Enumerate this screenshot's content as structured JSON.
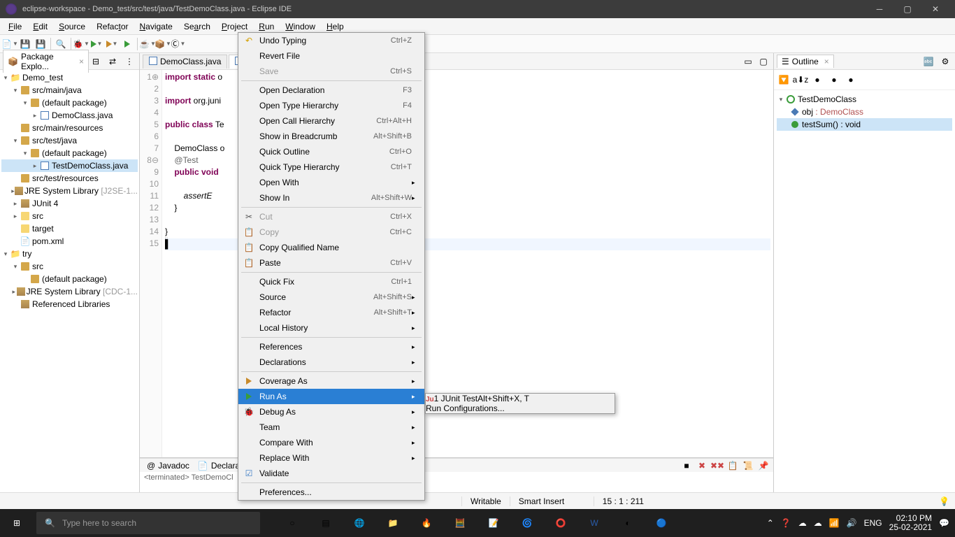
{
  "window": {
    "title": "eclipse-workspace - Demo_test/src/test/java/TestDemoClass.java - Eclipse IDE"
  },
  "menubar": [
    "File",
    "Edit",
    "Source",
    "Refactor",
    "Navigate",
    "Search",
    "Project",
    "Run",
    "Window",
    "Help"
  ],
  "package_explorer": {
    "title": "Package Explo...",
    "tree": {
      "project1": "Demo_test",
      "srcmainjava": "src/main/java",
      "defpkg1": "(default package)",
      "democlass": "DemoClass.java",
      "srcmainres": "src/main/resources",
      "srctestjava": "src/test/java",
      "defpkg2": "(default package)",
      "testdemo": "TestDemoClass.java",
      "srctestres": "src/test/resources",
      "jre1": "JRE System Library",
      "jre1ver": "[J2SE-1...",
      "junit": "JUnit 4",
      "src": "src",
      "target": "target",
      "pom": "pom.xml",
      "project2": "try",
      "src2": "src",
      "defpkg3": "(default package)",
      "jre2": "JRE System Library",
      "jre2ver": "[CDC-1...",
      "reflib": "Referenced Libraries"
    }
  },
  "editor": {
    "tab1": "DemoClass.java",
    "tab2_prefix": "T",
    "lines": [
      "import static o",
      "",
      "import org.juni",
      "",
      "public class Te",
      "",
      "    DemoClass o",
      "    @Test",
      "    public void",
      "",
      "        assertE",
      "    }",
      "",
      "}",
      ""
    ]
  },
  "context_menu": {
    "items": [
      {
        "label": "Undo Typing",
        "key": "Ctrl+Z",
        "icon": "undo"
      },
      {
        "label": "Revert File"
      },
      {
        "label": "Save",
        "key": "Ctrl+S",
        "disabled": true
      },
      {
        "sep": true
      },
      {
        "label": "Open Declaration",
        "key": "F3"
      },
      {
        "label": "Open Type Hierarchy",
        "key": "F4"
      },
      {
        "label": "Open Call Hierarchy",
        "key": "Ctrl+Alt+H"
      },
      {
        "label": "Show in Breadcrumb",
        "key": "Alt+Shift+B"
      },
      {
        "label": "Quick Outline",
        "key": "Ctrl+O"
      },
      {
        "label": "Quick Type Hierarchy",
        "key": "Ctrl+T"
      },
      {
        "label": "Open With",
        "arrow": true
      },
      {
        "label": "Show In",
        "key": "Alt+Shift+W",
        "arrow": true
      },
      {
        "sep": true
      },
      {
        "label": "Cut",
        "key": "Ctrl+X",
        "icon": "cut",
        "disabled": true
      },
      {
        "label": "Copy",
        "key": "Ctrl+C",
        "icon": "copy",
        "disabled": true
      },
      {
        "label": "Copy Qualified Name",
        "icon": "copyq"
      },
      {
        "label": "Paste",
        "key": "Ctrl+V",
        "icon": "paste"
      },
      {
        "sep": true
      },
      {
        "label": "Quick Fix",
        "key": "Ctrl+1"
      },
      {
        "label": "Source",
        "key": "Alt+Shift+S",
        "arrow": true
      },
      {
        "label": "Refactor",
        "key": "Alt+Shift+T",
        "arrow": true
      },
      {
        "label": "Local History",
        "arrow": true
      },
      {
        "sep": true
      },
      {
        "label": "References",
        "arrow": true
      },
      {
        "label": "Declarations",
        "arrow": true
      },
      {
        "sep": true
      },
      {
        "label": "Coverage As",
        "arrow": true,
        "icon": "coverage"
      },
      {
        "label": "Run As",
        "arrow": true,
        "icon": "run",
        "highlighted": true
      },
      {
        "label": "Debug As",
        "arrow": true,
        "icon": "debug"
      },
      {
        "label": "Team",
        "arrow": true
      },
      {
        "label": "Compare With",
        "arrow": true
      },
      {
        "label": "Replace With",
        "arrow": true
      },
      {
        "label": "Validate",
        "icon": "check"
      },
      {
        "sep": true
      },
      {
        "label": "Preferences..."
      }
    ]
  },
  "submenu": {
    "items": [
      {
        "label": "1 JUnit Test",
        "key": "Alt+Shift+X, T",
        "icon": "junit",
        "highlighted": true
      },
      {
        "sep": true
      },
      {
        "label": "Run Configurations..."
      }
    ]
  },
  "outline": {
    "title": "Outline",
    "class": "TestDemoClass",
    "field": "obj",
    "field_type": ": DemoClass",
    "method": "testSum() : void"
  },
  "bottom": {
    "tab1": "Javadoc",
    "tab2": "Declarati",
    "console": "<terminated> TestDemoCl"
  },
  "statusbar": {
    "writable": "Writable",
    "insert": "Smart Insert",
    "pos": "15 : 1 : 211"
  },
  "taskbar": {
    "search_placeholder": "Type here to search",
    "lang": "ENG",
    "time": "02:10 PM",
    "date": "25-02-2021"
  }
}
